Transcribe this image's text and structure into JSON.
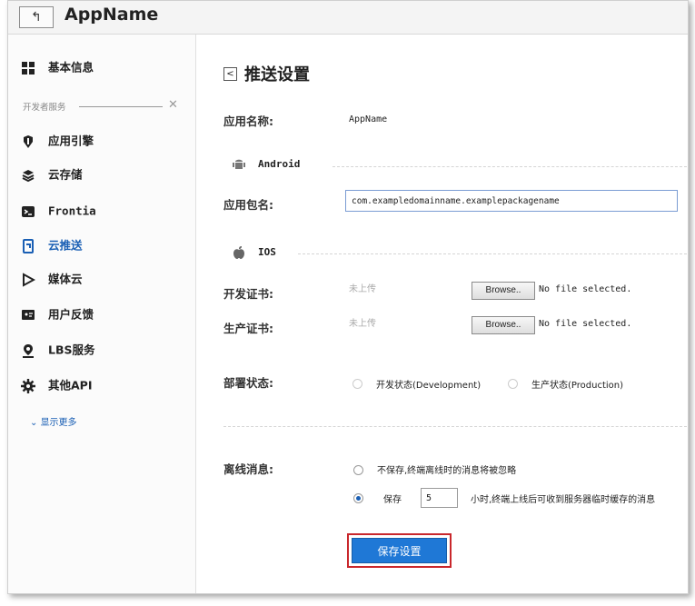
{
  "app": {
    "back_glyph": "↰",
    "title": "AppName"
  },
  "sidebar": {
    "item_basic": {
      "label": "基本信息",
      "icon": "grid-icon"
    },
    "dev_services_label": "开发者服务",
    "items": [
      {
        "label": "应用引擎",
        "icon": "engine-icon"
      },
      {
        "label": "云存储",
        "icon": "storage-icon"
      },
      {
        "label": "Frontia",
        "icon": "terminal-icon"
      },
      {
        "label": "云推送",
        "icon": "push-icon",
        "active": true
      },
      {
        "label": "媒体云",
        "icon": "play-icon"
      },
      {
        "label": "用户反馈",
        "icon": "feedback-icon"
      },
      {
        "label": "LBS服务",
        "icon": "location-icon"
      },
      {
        "label": "其他API",
        "icon": "gear-icon"
      }
    ],
    "show_more": "显示更多"
  },
  "main": {
    "title": "推送设置",
    "app_name_label": "应用名称:",
    "app_name_value": "AppName",
    "android_section": "Android",
    "package_label": "应用包名:",
    "package_value": "com.exampledomainname.examplepackagename",
    "ios_section": "IOS",
    "dev_cert_label": "开发证书:",
    "dev_cert_status": "未上传",
    "prod_cert_label": "生产证书:",
    "prod_cert_status": "未上传",
    "browse_label": "Browse..",
    "no_file": "No file selected.",
    "deploy_label": "部署状态:",
    "deploy_dev": "开发状态(Development)",
    "deploy_prod": "生产状态(Production)",
    "offline_label": "离线消息:",
    "offline_no_save": "不保存,终端离线时的消息将被忽略",
    "offline_save": "保存",
    "offline_hours": "5",
    "offline_hours_suffix": "小时,终端上线后可收到服务器临时缓存的消息",
    "save_button": "保存设置"
  },
  "colors": {
    "accent": "#1f78d6",
    "highlight_border": "#c9272c",
    "link": "#1a5fb4"
  }
}
